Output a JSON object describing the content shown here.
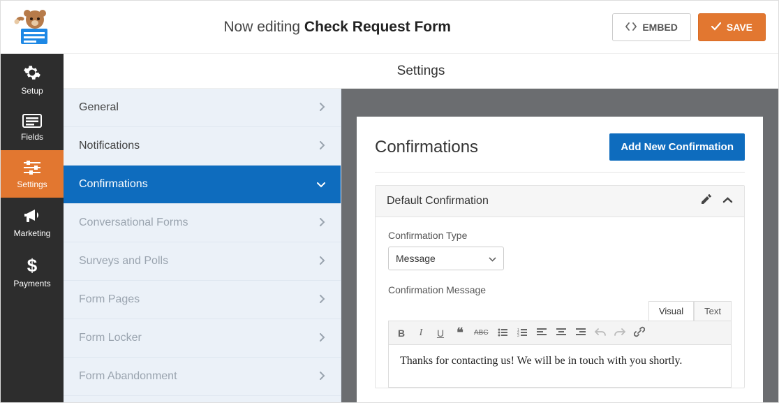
{
  "header": {
    "editing_prefix": "Now editing ",
    "form_name": "Check Request Form",
    "embed_label": "EMBED",
    "save_label": "SAVE"
  },
  "vnav": [
    {
      "label": "Setup"
    },
    {
      "label": "Fields"
    },
    {
      "label": "Settings"
    },
    {
      "label": "Marketing"
    },
    {
      "label": "Payments"
    }
  ],
  "right_header": "Settings",
  "settings_items": [
    {
      "label": "General",
      "state": "normal"
    },
    {
      "label": "Notifications",
      "state": "normal"
    },
    {
      "label": "Confirmations",
      "state": "active"
    },
    {
      "label": "Conversational Forms",
      "state": "muted"
    },
    {
      "label": "Surveys and Polls",
      "state": "muted"
    },
    {
      "label": "Form Pages",
      "state": "muted"
    },
    {
      "label": "Form Locker",
      "state": "muted"
    },
    {
      "label": "Form Abandonment",
      "state": "muted"
    }
  ],
  "confirmations": {
    "title": "Confirmations",
    "add_button": "Add New Confirmation",
    "default": {
      "name": "Default Confirmation",
      "type_label": "Confirmation Type",
      "type_value": "Message",
      "message_label": "Confirmation Message",
      "tabs": {
        "visual": "Visual",
        "text": "Text"
      },
      "message_body": "Thanks for contacting us! We will be in touch with you shortly."
    }
  },
  "colors": {
    "accent_orange": "#e27730",
    "accent_blue": "#0e6cbe"
  }
}
